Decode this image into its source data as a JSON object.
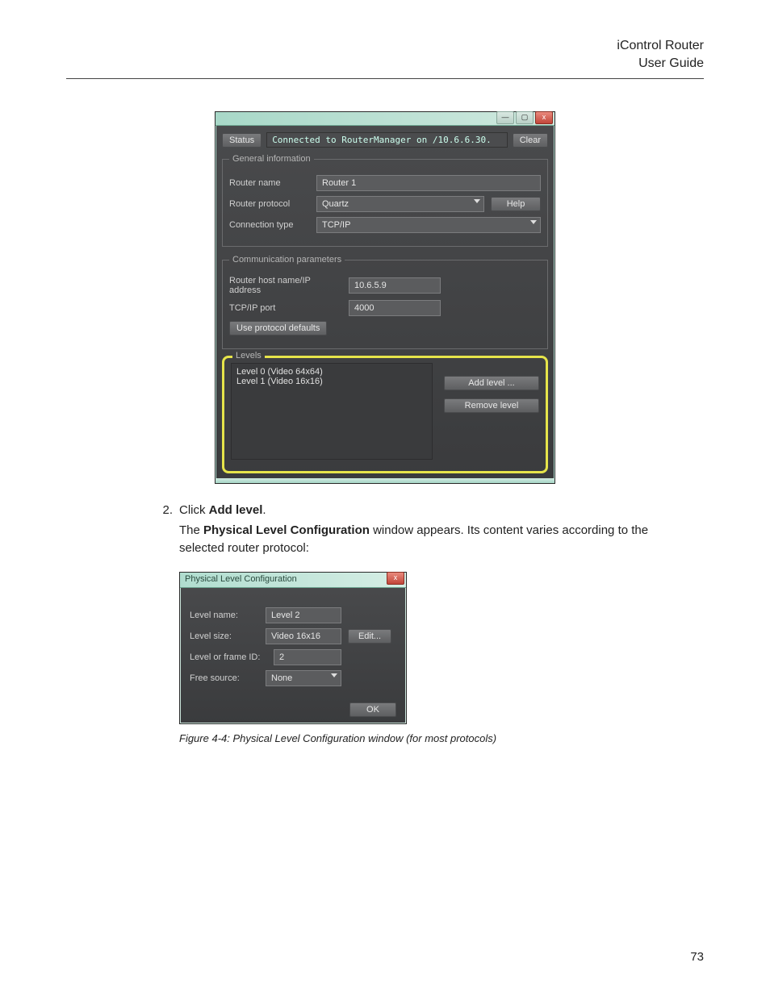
{
  "header": {
    "line1": "iControl Router",
    "line2": "User Guide"
  },
  "page_number": "73",
  "window1": {
    "winbtns": {
      "min": "—",
      "max": "▢",
      "close": "x"
    },
    "status_label": "Status",
    "status_text": "Connected to RouterManager on /10.6.6.30.",
    "clear": "Clear",
    "general_legend": "General information",
    "router_name_lbl": "Router name",
    "router_name_val": "Router 1",
    "router_protocol_lbl": "Router protocol",
    "router_protocol_val": "Quartz",
    "help": "Help",
    "connection_type_lbl": "Connection type",
    "connection_type_val": "TCP/IP",
    "comm_legend": "Communication parameters",
    "host_lbl": "Router host name/IP address",
    "host_val": "10.6.5.9",
    "port_lbl": "TCP/IP port",
    "port_val": "4000",
    "defaults_btn": "Use protocol defaults",
    "levels_legend": "Levels",
    "levels": [
      "Level 0 (Video 64x64)",
      "Level 1 (Video 16x16)"
    ],
    "add_level": "Add level ...",
    "remove_level": "Remove level"
  },
  "step": {
    "num": "2.",
    "pre": "Click ",
    "bold": "Add level",
    "post": "."
  },
  "para": {
    "pre": "The ",
    "bold": "Physical Level Configuration",
    "post": " window appears. Its content varies according to the selected router protocol:"
  },
  "window2": {
    "title": "Physical Level Configuration",
    "close": "x",
    "level_name_lbl": "Level name:",
    "level_name_val": "Level 2",
    "level_size_lbl": "Level size:",
    "level_size_val": "Video 16x16",
    "edit": "Edit...",
    "level_id_lbl": "Level or frame ID:",
    "level_id_val": "2",
    "free_src_lbl": "Free source:",
    "free_src_val": "None",
    "ok": "OK"
  },
  "caption": "Figure 4-4:  Physical Level Configuration window (for most protocols)"
}
